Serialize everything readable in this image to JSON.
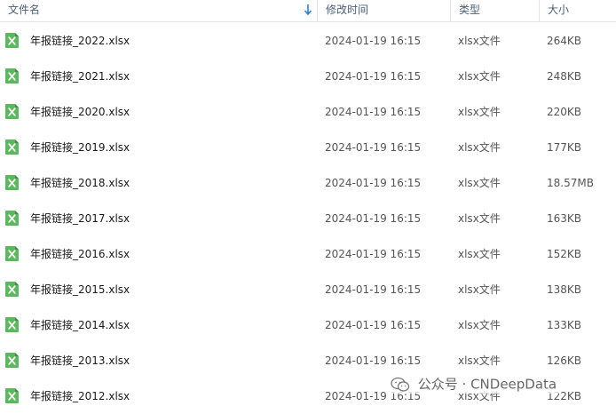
{
  "columns": {
    "name": "文件名",
    "date": "修改时间",
    "type": "类型",
    "size": "大小"
  },
  "files": [
    {
      "name": "年报链接_2022.xlsx",
      "date": "2024-01-19 16:15",
      "type": "xlsx文件",
      "size": "264KB"
    },
    {
      "name": "年报链接_2021.xlsx",
      "date": "2024-01-19 16:15",
      "type": "xlsx文件",
      "size": "248KB"
    },
    {
      "name": "年报链接_2020.xlsx",
      "date": "2024-01-19 16:15",
      "type": "xlsx文件",
      "size": "220KB"
    },
    {
      "name": "年报链接_2019.xlsx",
      "date": "2024-01-19 16:15",
      "type": "xlsx文件",
      "size": "177KB"
    },
    {
      "name": "年报链接_2018.xlsx",
      "date": "2024-01-19 16:15",
      "type": "xlsx文件",
      "size": "18.57MB"
    },
    {
      "name": "年报链接_2017.xlsx",
      "date": "2024-01-19 16:15",
      "type": "xlsx文件",
      "size": "163KB"
    },
    {
      "name": "年报链接_2016.xlsx",
      "date": "2024-01-19 16:15",
      "type": "xlsx文件",
      "size": "152KB"
    },
    {
      "name": "年报链接_2015.xlsx",
      "date": "2024-01-19 16:15",
      "type": "xlsx文件",
      "size": "138KB"
    },
    {
      "name": "年报链接_2014.xlsx",
      "date": "2024-01-19 16:15",
      "type": "xlsx文件",
      "size": "133KB"
    },
    {
      "name": "年报链接_2013.xlsx",
      "date": "2024-01-19 16:15",
      "type": "xlsx文件",
      "size": "126KB"
    },
    {
      "name": "年报链接_2012.xlsx",
      "date": "2024-01-19 16:15",
      "type": "xlsx文件",
      "size": "122KB"
    }
  ],
  "file_icon": "excel-file-icon",
  "sort_icon": "sort-descending-icon",
  "watermark": {
    "logo": "wechat-logo",
    "text": "公众号 · CNDeepData"
  },
  "colors": {
    "header_text": "#4c607a",
    "sort_arrow": "#2f7fd6",
    "icon_green": "#4caf50"
  }
}
